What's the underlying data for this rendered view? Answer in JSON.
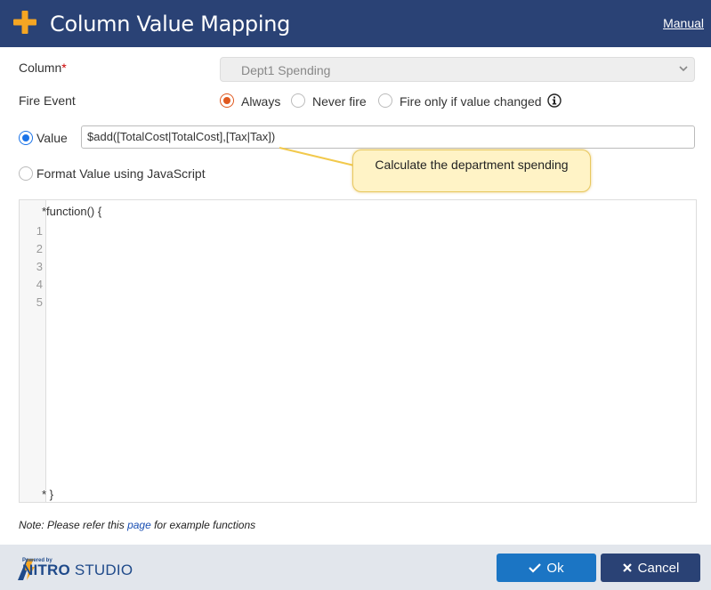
{
  "header": {
    "title": "Column Value Mapping",
    "manual_label": "Manual"
  },
  "column": {
    "label": "Column",
    "required_mark": "*",
    "selected": "Dept1 Spending"
  },
  "fire_event": {
    "label": "Fire Event",
    "options": [
      "Always",
      "Never fire",
      "Fire only if value changed"
    ],
    "selected": "Always"
  },
  "value_mode": {
    "value_label": "Value",
    "value_expression": "$add([TotalCost|TotalCost],[Tax|Tax])",
    "js_label": "Format Value using JavaScript",
    "selected": "Value"
  },
  "callout": {
    "text": "Calculate the department spending"
  },
  "editor": {
    "first_line": "*function() {",
    "last_line": "* }",
    "line_numbers": [
      "1",
      "2",
      "3",
      "4",
      "5"
    ]
  },
  "note": {
    "prefix": "Note: Please refer this ",
    "link": "page",
    "suffix": " for example functions"
  },
  "footer": {
    "powered_by": "Powered by",
    "brand_nitro": "NITRO",
    "brand_studio": " STUDIO",
    "ok_label": "Ok",
    "cancel_label": "Cancel"
  },
  "colors": {
    "header_bg": "#2a4275",
    "accent_orange": "#f5a623",
    "ok_blue": "#1b75c4",
    "radio_orange": "#e0591f"
  }
}
